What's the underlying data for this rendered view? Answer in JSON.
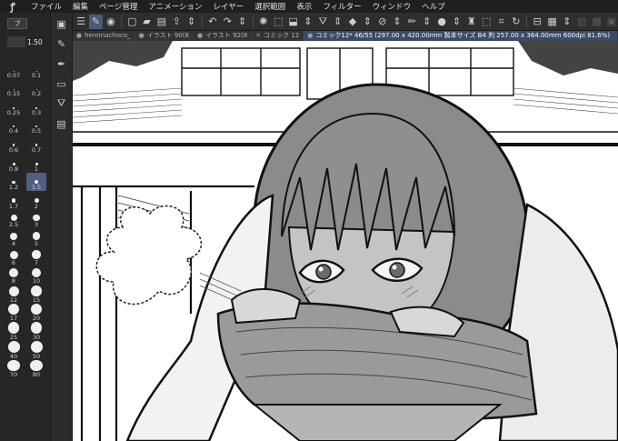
{
  "menu": {
    "app_logo": "ꝭ",
    "items": [
      "ファイル",
      "編集",
      "ページ管理",
      "アニメーション",
      "レイヤー",
      "選択範囲",
      "表示",
      "フィルター",
      "ウィンドウ",
      "ヘルプ"
    ]
  },
  "brush_panel": {
    "mini_label": "ブ",
    "current_size": "1.50",
    "sizes": [
      {
        "label": "0.07",
        "d": 1
      },
      {
        "label": "0.1",
        "d": 1
      },
      {
        "label": "0.15",
        "d": 1
      },
      {
        "label": "0.2",
        "d": 1
      },
      {
        "label": "0.25",
        "d": 1.5
      },
      {
        "label": "0.3",
        "d": 1.5
      },
      {
        "label": "0.4",
        "d": 2
      },
      {
        "label": "0.5",
        "d": 2
      },
      {
        "label": "0.6",
        "d": 2.5
      },
      {
        "label": "0.7",
        "d": 2.5
      },
      {
        "label": "0.8",
        "d": 3
      },
      {
        "label": "1",
        "d": 3
      },
      {
        "label": "1.2",
        "d": 3.5
      },
      {
        "label": "1.5",
        "d": 4
      },
      {
        "label": "1.7",
        "d": 4.5
      },
      {
        "label": "2",
        "d": 5
      },
      {
        "label": "2.5",
        "d": 7
      },
      {
        "label": "3",
        "d": 7.5
      },
      {
        "label": "4",
        "d": 8
      },
      {
        "label": "5",
        "d": 8.5
      },
      {
        "label": "6",
        "d": 9
      },
      {
        "label": "7",
        "d": 9.5
      },
      {
        "label": "8",
        "d": 10
      },
      {
        "label": "10",
        "d": 10.5
      },
      {
        "label": "12",
        "d": 11
      },
      {
        "label": "15",
        "d": 11.5
      },
      {
        "label": "17",
        "d": 12
      },
      {
        "label": "20",
        "d": 12
      },
      {
        "label": "25",
        "d": 12.5
      },
      {
        "label": "30",
        "d": 12.5
      },
      {
        "label": "40",
        "d": 13
      },
      {
        "label": "50",
        "d": 13
      },
      {
        "label": "70",
        "d": 13.5
      },
      {
        "label": "80",
        "d": 13.5
      }
    ],
    "selected_size": "1.5"
  },
  "tabs": [
    {
      "label": "hennnachoco_",
      "active": false
    },
    {
      "label": "イラスト 90(8",
      "active": false
    },
    {
      "label": "イラスト 92(8",
      "active": false
    },
    {
      "label": "コミック 12",
      "active": false
    },
    {
      "label": "コミック12* 46/55 (297.00 x 420.00mm 製本サイズ B4 判 257.00 x 364.00mm 600dpi 81.6%)",
      "active": true
    }
  ],
  "colors": {
    "accent": "#4f5f80",
    "tab_active": "#3c4a66",
    "menubar": "#1f1f1f",
    "panel": "#262626"
  }
}
